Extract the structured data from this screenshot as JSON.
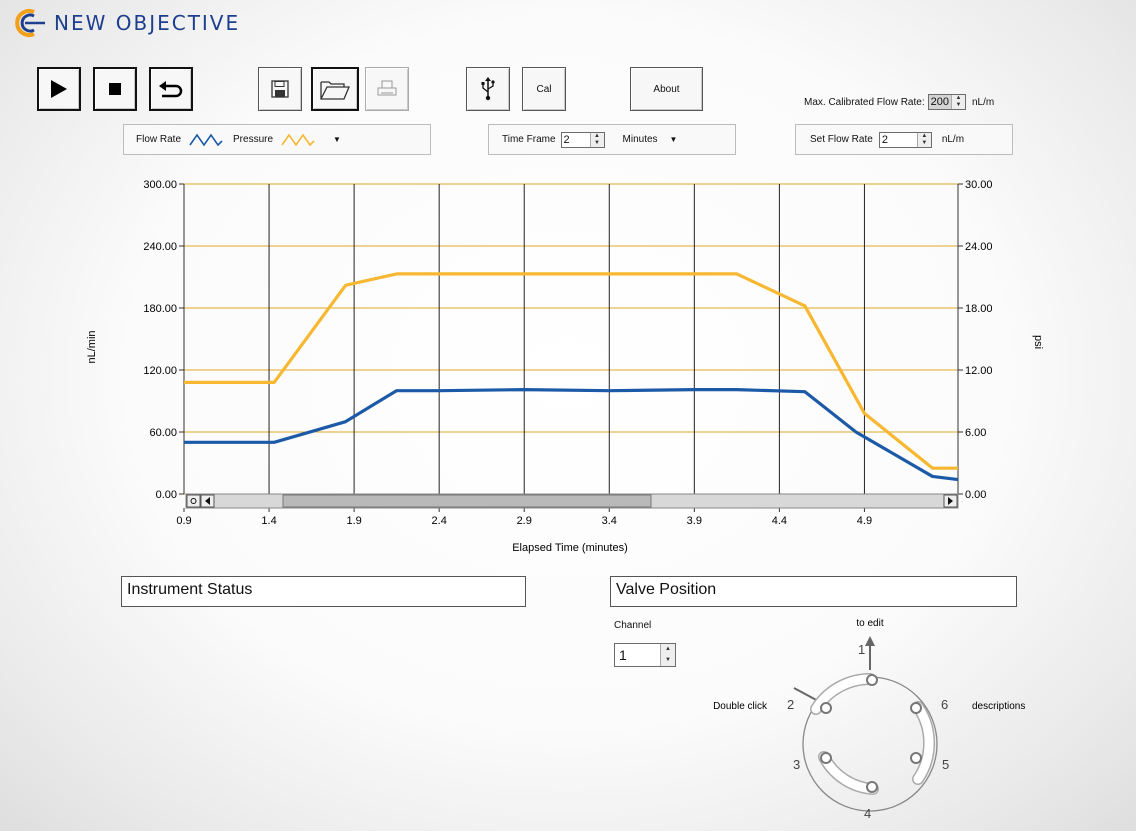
{
  "logo": {
    "text": "NEW OBJECTIVE"
  },
  "toolbar": {
    "cal_label": "Cal",
    "about_label": "About"
  },
  "max_cal": {
    "label": "Max. Calibrated Flow Rate:",
    "value": "200",
    "unit": "nL/m"
  },
  "legend": {
    "flow_label": "Flow Rate",
    "pressure_label": "Pressure"
  },
  "time_frame": {
    "label": "Time Frame",
    "value": "2",
    "unit": "Minutes"
  },
  "set_flow": {
    "label": "Set Flow Rate",
    "value": "2",
    "unit": "nL/m"
  },
  "colors": {
    "flow": "#1c5aa8",
    "pressure": "#f7b731",
    "grid_h": "#e0a825",
    "grid_v": "#222222"
  },
  "chart_data": {
    "type": "line",
    "xlabel": "Elapsed Time (minutes)",
    "ylabel": "nL/min",
    "y2label": "psi",
    "xlim": [
      0.9,
      5.45
    ],
    "ylim": [
      0,
      300
    ],
    "y2lim": [
      0,
      30
    ],
    "x_ticks": [
      "0.9",
      "1.4",
      "1.9",
      "2.4",
      "2.9",
      "3.4",
      "3.9",
      "4.4",
      "4.9"
    ],
    "y_ticks": [
      "0.00",
      "60.00",
      "120.00",
      "180.00",
      "240.00",
      "300.00"
    ],
    "y2_ticks": [
      "0.00",
      "6.00",
      "12.00",
      "18.00",
      "24.00",
      "30.00"
    ],
    "grid": true,
    "series": [
      {
        "name": "Flow Rate",
        "axis": "left",
        "x": [
          0.9,
          1.43,
          1.85,
          2.15,
          2.4,
          2.9,
          3.4,
          3.9,
          4.15,
          4.55,
          4.85,
          5.3,
          5.45
        ],
        "y": [
          50,
          50,
          70,
          100,
          100,
          101,
          100,
          101,
          101,
          99,
          60,
          17,
          14
        ]
      },
      {
        "name": "Pressure",
        "axis": "right",
        "x": [
          0.9,
          1.43,
          1.85,
          2.15,
          2.4,
          2.9,
          3.4,
          3.9,
          4.15,
          4.55,
          4.9,
          5.3,
          5.45
        ],
        "y": [
          10.8,
          10.8,
          20.2,
          21.3,
          21.3,
          21.3,
          21.3,
          21.3,
          21.3,
          18.2,
          7.8,
          2.5,
          2.5
        ]
      }
    ]
  },
  "instrument_status": {
    "label": "Instrument Status"
  },
  "valve_position": {
    "label": "Valve Position"
  },
  "channel": {
    "label": "Channel",
    "value": "1"
  },
  "valve": {
    "to_edit": "to edit",
    "double_click": "Double click",
    "descriptions": "descriptions",
    "ports": [
      "1",
      "2",
      "3",
      "4",
      "5",
      "6"
    ]
  }
}
